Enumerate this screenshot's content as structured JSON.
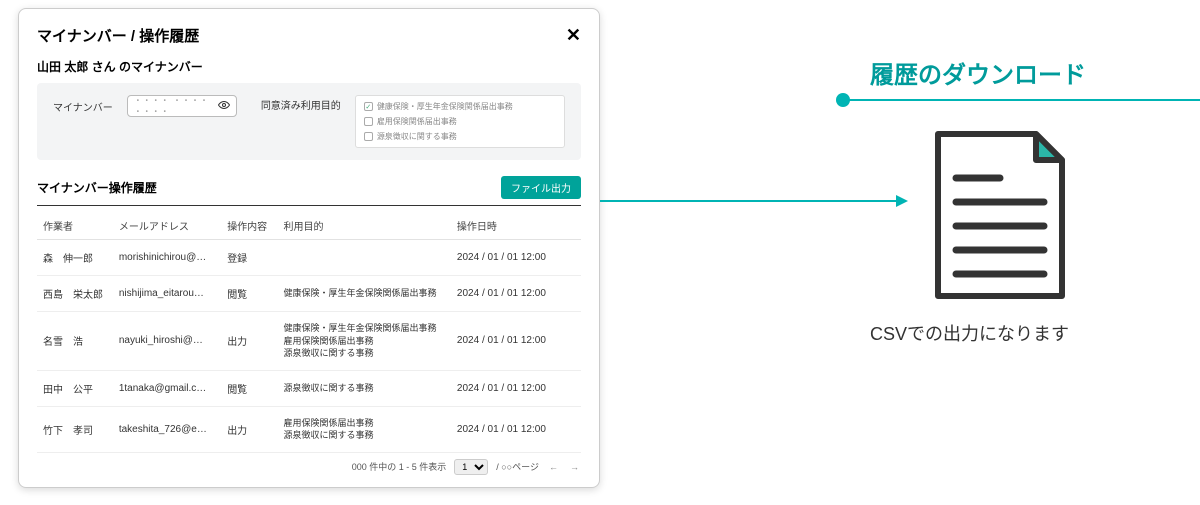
{
  "modal": {
    "title": "マイナンバー / 操作履歴",
    "subtitle": "山田 太郎 さん のマイナンバー",
    "field_label": "マイナンバー",
    "masked_placeholder": "・・・・ ・・・・ ・・・・",
    "consent_label": "同意済み利用目的",
    "consent_options": [
      {
        "label": "健康保険・厚生年金保険関係届出事務",
        "checked": true
      },
      {
        "label": "雇用保険関係届出事務",
        "checked": false
      },
      {
        "label": "源泉徴収に関する事務",
        "checked": false
      }
    ]
  },
  "history": {
    "section_title": "マイナンバー操作履歴",
    "export_button": "ファイル出力",
    "columns": {
      "operator": "作業者",
      "email": "メールアドレス",
      "action": "操作内容",
      "purpose": "利用目的",
      "datetime": "操作日時"
    },
    "rows": [
      {
        "operator": "森　伸一郎",
        "email": "morishinichirou@…",
        "action": "登録",
        "purpose": "",
        "datetime": "2024 / 01 / 01  12:00"
      },
      {
        "operator": "西島　栄太郎",
        "email": "nishijima_eitarou…",
        "action": "閲覧",
        "purpose": "健康保険・厚生年金保険関係届出事務",
        "datetime": "2024 / 01 / 01  12:00"
      },
      {
        "operator": "名雪　浩",
        "email": "nayuki_hiroshi@…",
        "action": "出力",
        "purpose": "健康保険・厚生年金保険関係届出事務\n雇用保険関係届出事務\n源泉徴収に関する事務",
        "datetime": "2024 / 01 / 01  12:00"
      },
      {
        "operator": "田中　公平",
        "email": "1tanaka@gmail.c…",
        "action": "閲覧",
        "purpose": "源泉徴収に関する事務",
        "datetime": "2024 / 01 / 01  12:00"
      },
      {
        "operator": "竹下　孝司",
        "email": "takeshita_726@e…",
        "action": "出力",
        "purpose": "雇用保険関係届出事務\n源泉徴収に関する事務",
        "datetime": "2024 / 01 / 01  12:00"
      }
    ],
    "pager": {
      "summary": "000 件中の 1 - 5 件表示",
      "page_select": "1",
      "page_total": "/ ○○ページ"
    }
  },
  "callout": {
    "title": "履歴のダウンロード",
    "caption": "CSVでの出力になります"
  }
}
